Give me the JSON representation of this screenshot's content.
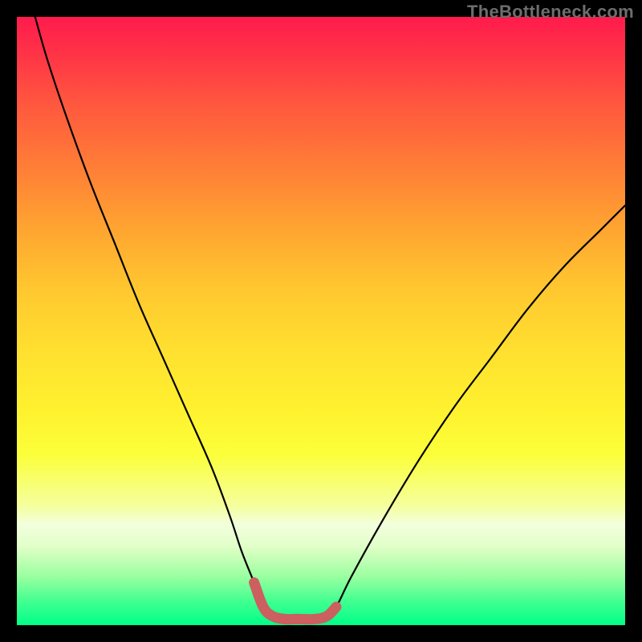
{
  "watermark": {
    "text": "TheBottleneck.com"
  },
  "chart_data": {
    "type": "line",
    "title": "",
    "xlabel": "",
    "ylabel": "",
    "xlim": [
      0,
      100
    ],
    "ylim": [
      0,
      100
    ],
    "series": [
      {
        "name": "bottleneck-curve",
        "x": [
          3,
          5,
          8,
          12,
          16,
          20,
          24,
          28,
          32,
          35,
          37,
          39,
          40.5,
          42,
          44,
          46,
          49,
          51,
          52.5,
          55,
          60,
          66,
          72,
          78,
          84,
          90,
          96,
          100
        ],
        "values": [
          100,
          93,
          84,
          73,
          63,
          53,
          44,
          35,
          26,
          18,
          12,
          7,
          3,
          1.5,
          1,
          1,
          1,
          1.5,
          3,
          8,
          17,
          27,
          36,
          44,
          52,
          59,
          65,
          69
        ]
      }
    ],
    "annotations": [
      {
        "name": "trough-highlight",
        "x": [
          39,
          40.5,
          42,
          44,
          46,
          49,
          51,
          52.5
        ],
        "values": [
          7,
          3,
          1.5,
          1,
          1,
          1,
          1.5,
          3
        ],
        "color": "#cc5f5f"
      }
    ],
    "gradient_stops": [
      {
        "pos": 0,
        "color": "#ff1b4c"
      },
      {
        "pos": 25,
        "color": "#ff7f36"
      },
      {
        "pos": 55,
        "color": "#ffe02f"
      },
      {
        "pos": 83,
        "color": "#f2ffde"
      },
      {
        "pos": 100,
        "color": "#00ff88"
      }
    ]
  }
}
